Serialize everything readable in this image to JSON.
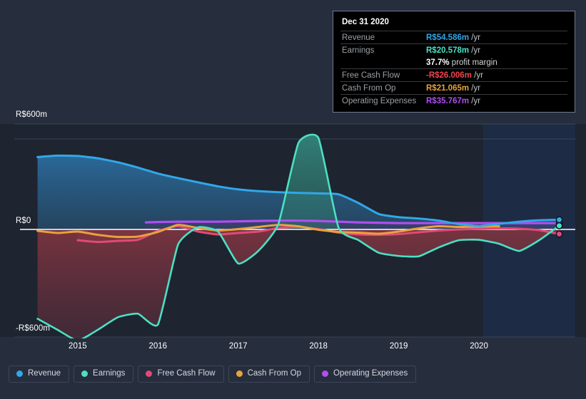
{
  "chart_data": {
    "type": "area",
    "title": "",
    "xlabel": "",
    "ylabel": "",
    "currency_prefix": "R$",
    "ylim": [
      -600,
      600
    ],
    "xlim": [
      2014.45,
      2021.2
    ],
    "grid": true,
    "y_ticks": [
      {
        "value": 600,
        "label": "R$600m"
      },
      {
        "value": 0,
        "label": "R$0"
      },
      {
        "value": -600,
        "label": "-R$600m"
      }
    ],
    "x_ticks": [
      {
        "value": 2015,
        "label": "2015"
      },
      {
        "value": 2016,
        "label": "2016"
      },
      {
        "value": 2017,
        "label": "2017"
      },
      {
        "value": 2018,
        "label": "2018"
      },
      {
        "value": 2019,
        "label": "2019"
      },
      {
        "value": 2020,
        "label": "2020"
      }
    ],
    "forecast_region": {
      "start": 2020.05,
      "end": 2021.2
    },
    "colors": {
      "revenue": "#31a7e8",
      "earnings": "#4ce0c3",
      "free_cash_flow": "#e04a77",
      "cash_from_op": "#e8a33d",
      "operating_expenses": "#b04ef0",
      "zero_line": "#ffffff",
      "grid": "#394154",
      "background": "#262d3d",
      "plot_background": "#1e2430"
    },
    "series": [
      {
        "name": "Revenue",
        "key": "revenue",
        "color": "#31a7e8",
        "x": [
          2014.5,
          2014.75,
          2015.0,
          2015.25,
          2015.5,
          2015.75,
          2016.0,
          2016.25,
          2016.5,
          2016.75,
          2017.0,
          2017.25,
          2017.5,
          2017.75,
          2018.0,
          2018.25,
          2018.5,
          2018.75,
          2019.0,
          2019.25,
          2019.5,
          2019.75,
          2020.0,
          2020.25,
          2020.5,
          2020.75,
          2021.0
        ],
        "values": [
          412,
          420,
          418,
          405,
          382,
          352,
          318,
          292,
          268,
          245,
          228,
          218,
          212,
          208,
          205,
          200,
          150,
          88,
          70,
          62,
          50,
          30,
          20,
          32,
          44,
          52,
          55
        ]
      },
      {
        "name": "Earnings",
        "key": "earnings",
        "color": "#4ce0c3",
        "x": [
          2014.5,
          2014.75,
          2015.0,
          2015.25,
          2015.5,
          2015.75,
          2016.0,
          2016.25,
          2016.5,
          2016.75,
          2017.0,
          2017.25,
          2017.5,
          2017.75,
          2018.0,
          2018.25,
          2018.5,
          2018.75,
          2019.0,
          2019.25,
          2019.5,
          2019.75,
          2020.0,
          2020.25,
          2020.5,
          2020.75,
          2021.0
        ],
        "values": [
          -498,
          -560,
          -620,
          -560,
          -490,
          -470,
          -530,
          -85,
          12,
          -12,
          -190,
          -120,
          30,
          492,
          520,
          10,
          -60,
          -130,
          -148,
          -150,
          -100,
          -60,
          -58,
          -80,
          -120,
          -60,
          21
        ]
      },
      {
        "name": "Free Cash Flow",
        "key": "free_cash_flow",
        "color": "#e04a77",
        "x": [
          2015.0,
          2015.25,
          2015.5,
          2015.75,
          2016.0,
          2016.25,
          2016.5,
          2016.75,
          2017.0,
          2017.25,
          2017.5,
          2017.75,
          2018.0,
          2018.25,
          2018.5,
          2018.75,
          2019.0,
          2019.25,
          2019.5,
          2019.75,
          2020.0,
          2020.25,
          2020.5,
          2020.75,
          2021.0
        ],
        "values": [
          -60,
          -70,
          -64,
          -58,
          -8,
          18,
          -12,
          -28,
          -20,
          -12,
          8,
          14,
          2,
          -18,
          -28,
          -30,
          -26,
          -16,
          -6,
          0,
          4,
          6,
          4,
          -4,
          -26
        ]
      },
      {
        "name": "Cash From Op",
        "key": "cash_from_op",
        "color": "#e8a33d",
        "x": [
          2014.5,
          2014.75,
          2015.0,
          2015.25,
          2015.5,
          2015.75,
          2016.0,
          2016.25,
          2016.5,
          2016.75,
          2017.0,
          2017.25,
          2017.5,
          2017.75,
          2018.0,
          2018.25,
          2018.5,
          2018.75,
          2019.0,
          2019.25,
          2019.5,
          2019.75,
          2020.0,
          2020.25,
          2020.5,
          2020.75,
          2021.0
        ],
        "values": [
          -8,
          -20,
          -12,
          -30,
          -42,
          -40,
          -14,
          26,
          8,
          -6,
          2,
          14,
          26,
          18,
          -2,
          -14,
          -18,
          -24,
          -12,
          6,
          18,
          14,
          16,
          18,
          21
        ]
      },
      {
        "name": "Operating Expenses",
        "key": "operating_expenses",
        "color": "#b04ef0",
        "x": [
          2015.85,
          2016.0,
          2016.25,
          2016.5,
          2016.75,
          2017.0,
          2017.25,
          2017.5,
          2017.75,
          2018.0,
          2018.25,
          2018.5,
          2018.75,
          2019.0,
          2019.25,
          2019.5,
          2019.75,
          2020.0,
          2020.25,
          2020.5,
          2020.75,
          2021.0
        ],
        "values": [
          40,
          42,
          44,
          44,
          44,
          46,
          48,
          50,
          50,
          48,
          44,
          40,
          38,
          36,
          36,
          36,
          36,
          36,
          36,
          36,
          36,
          36
        ]
      }
    ]
  },
  "tooltip": {
    "title": "Dec 31 2020",
    "rows": [
      {
        "label": "Revenue",
        "value": "R$54.586m",
        "unit": "/yr",
        "color": "#31a7e8"
      },
      {
        "label": "Earnings",
        "value": "R$20.578m",
        "unit": "/yr",
        "color": "#4ce0c3"
      },
      {
        "label": "",
        "value": "37.7%",
        "unit": "profit margin",
        "color": "#ffffff",
        "sub": true
      },
      {
        "label": "Free Cash Flow",
        "value": "-R$26.006m",
        "unit": "/yr",
        "color": "#f0444f"
      },
      {
        "label": "Cash From Op",
        "value": "R$21.065m",
        "unit": "/yr",
        "color": "#e8a33d"
      },
      {
        "label": "Operating Expenses",
        "value": "R$35.767m",
        "unit": "/yr",
        "color": "#b04ef0"
      }
    ]
  },
  "legend": {
    "items": [
      {
        "label": "Revenue",
        "color": "#31a7e8",
        "name": "legend-item-revenue"
      },
      {
        "label": "Earnings",
        "color": "#4ce0c3",
        "name": "legend-item-earnings"
      },
      {
        "label": "Free Cash Flow",
        "color": "#e04a77",
        "name": "legend-item-free-cash-flow"
      },
      {
        "label": "Cash From Op",
        "color": "#e8a33d",
        "name": "legend-item-cash-from-op"
      },
      {
        "label": "Operating Expenses",
        "color": "#b04ef0",
        "name": "legend-item-operating-expenses"
      }
    ]
  }
}
